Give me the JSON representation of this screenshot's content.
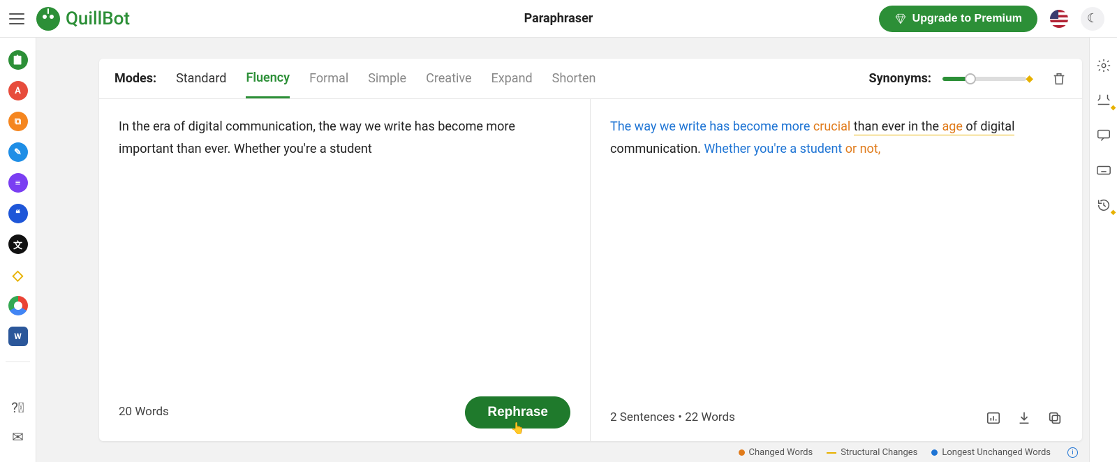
{
  "header": {
    "brand": "QuillBot",
    "page_title": "Paraphraser",
    "upgrade_label": "Upgrade to Premium"
  },
  "sidebar_left": {
    "items": [
      {
        "name": "paraphraser",
        "glyph": "📋"
      },
      {
        "name": "grammar-checker",
        "glyph": "A"
      },
      {
        "name": "plagiarism-checker",
        "glyph": "⧉"
      },
      {
        "name": "co-writer",
        "glyph": "✎"
      },
      {
        "name": "summarizer",
        "glyph": "≡"
      },
      {
        "name": "citation-generator",
        "glyph": "❝"
      },
      {
        "name": "translator",
        "glyph": "文"
      },
      {
        "name": "premium",
        "glyph": "◇"
      },
      {
        "name": "chrome-extension",
        "glyph": ""
      },
      {
        "name": "word-extension",
        "glyph": "W"
      }
    ]
  },
  "modes": {
    "label": "Modes:",
    "items": [
      {
        "label": "Standard",
        "state": "enabled"
      },
      {
        "label": "Fluency",
        "state": "active"
      },
      {
        "label": "Formal",
        "state": "locked"
      },
      {
        "label": "Simple",
        "state": "locked"
      },
      {
        "label": "Creative",
        "state": "locked"
      },
      {
        "label": "Expand",
        "state": "locked"
      },
      {
        "label": "Shorten",
        "state": "locked"
      }
    ],
    "synonyms_label": "Synonyms:"
  },
  "input": {
    "text": "In the era of digital communication, the way we write has become more important than ever. Whether you're a student",
    "word_count_label": "20 Words",
    "rephrase_label": "Rephrase"
  },
  "output": {
    "segments": [
      {
        "t": "The way we write has become more ",
        "cls": "blue"
      },
      {
        "t": "crucial",
        "cls": "orange"
      },
      {
        "t": " ",
        "cls": ""
      },
      {
        "t": "than ever in the ",
        "cls": "underline-y"
      },
      {
        "t": "age",
        "cls": "orange underline-y"
      },
      {
        "t": " of digital",
        "cls": "underline-y"
      },
      {
        "t": " communication. ",
        "cls": ""
      },
      {
        "t": "Whether you're a student ",
        "cls": "blue"
      },
      {
        "t": "or not,",
        "cls": "orange"
      }
    ],
    "stats_label": "2 Sentences  •  22 Words"
  },
  "legend": {
    "changed": "Changed Words",
    "structural": "Structural Changes",
    "longest": "Longest Unchanged Words"
  }
}
